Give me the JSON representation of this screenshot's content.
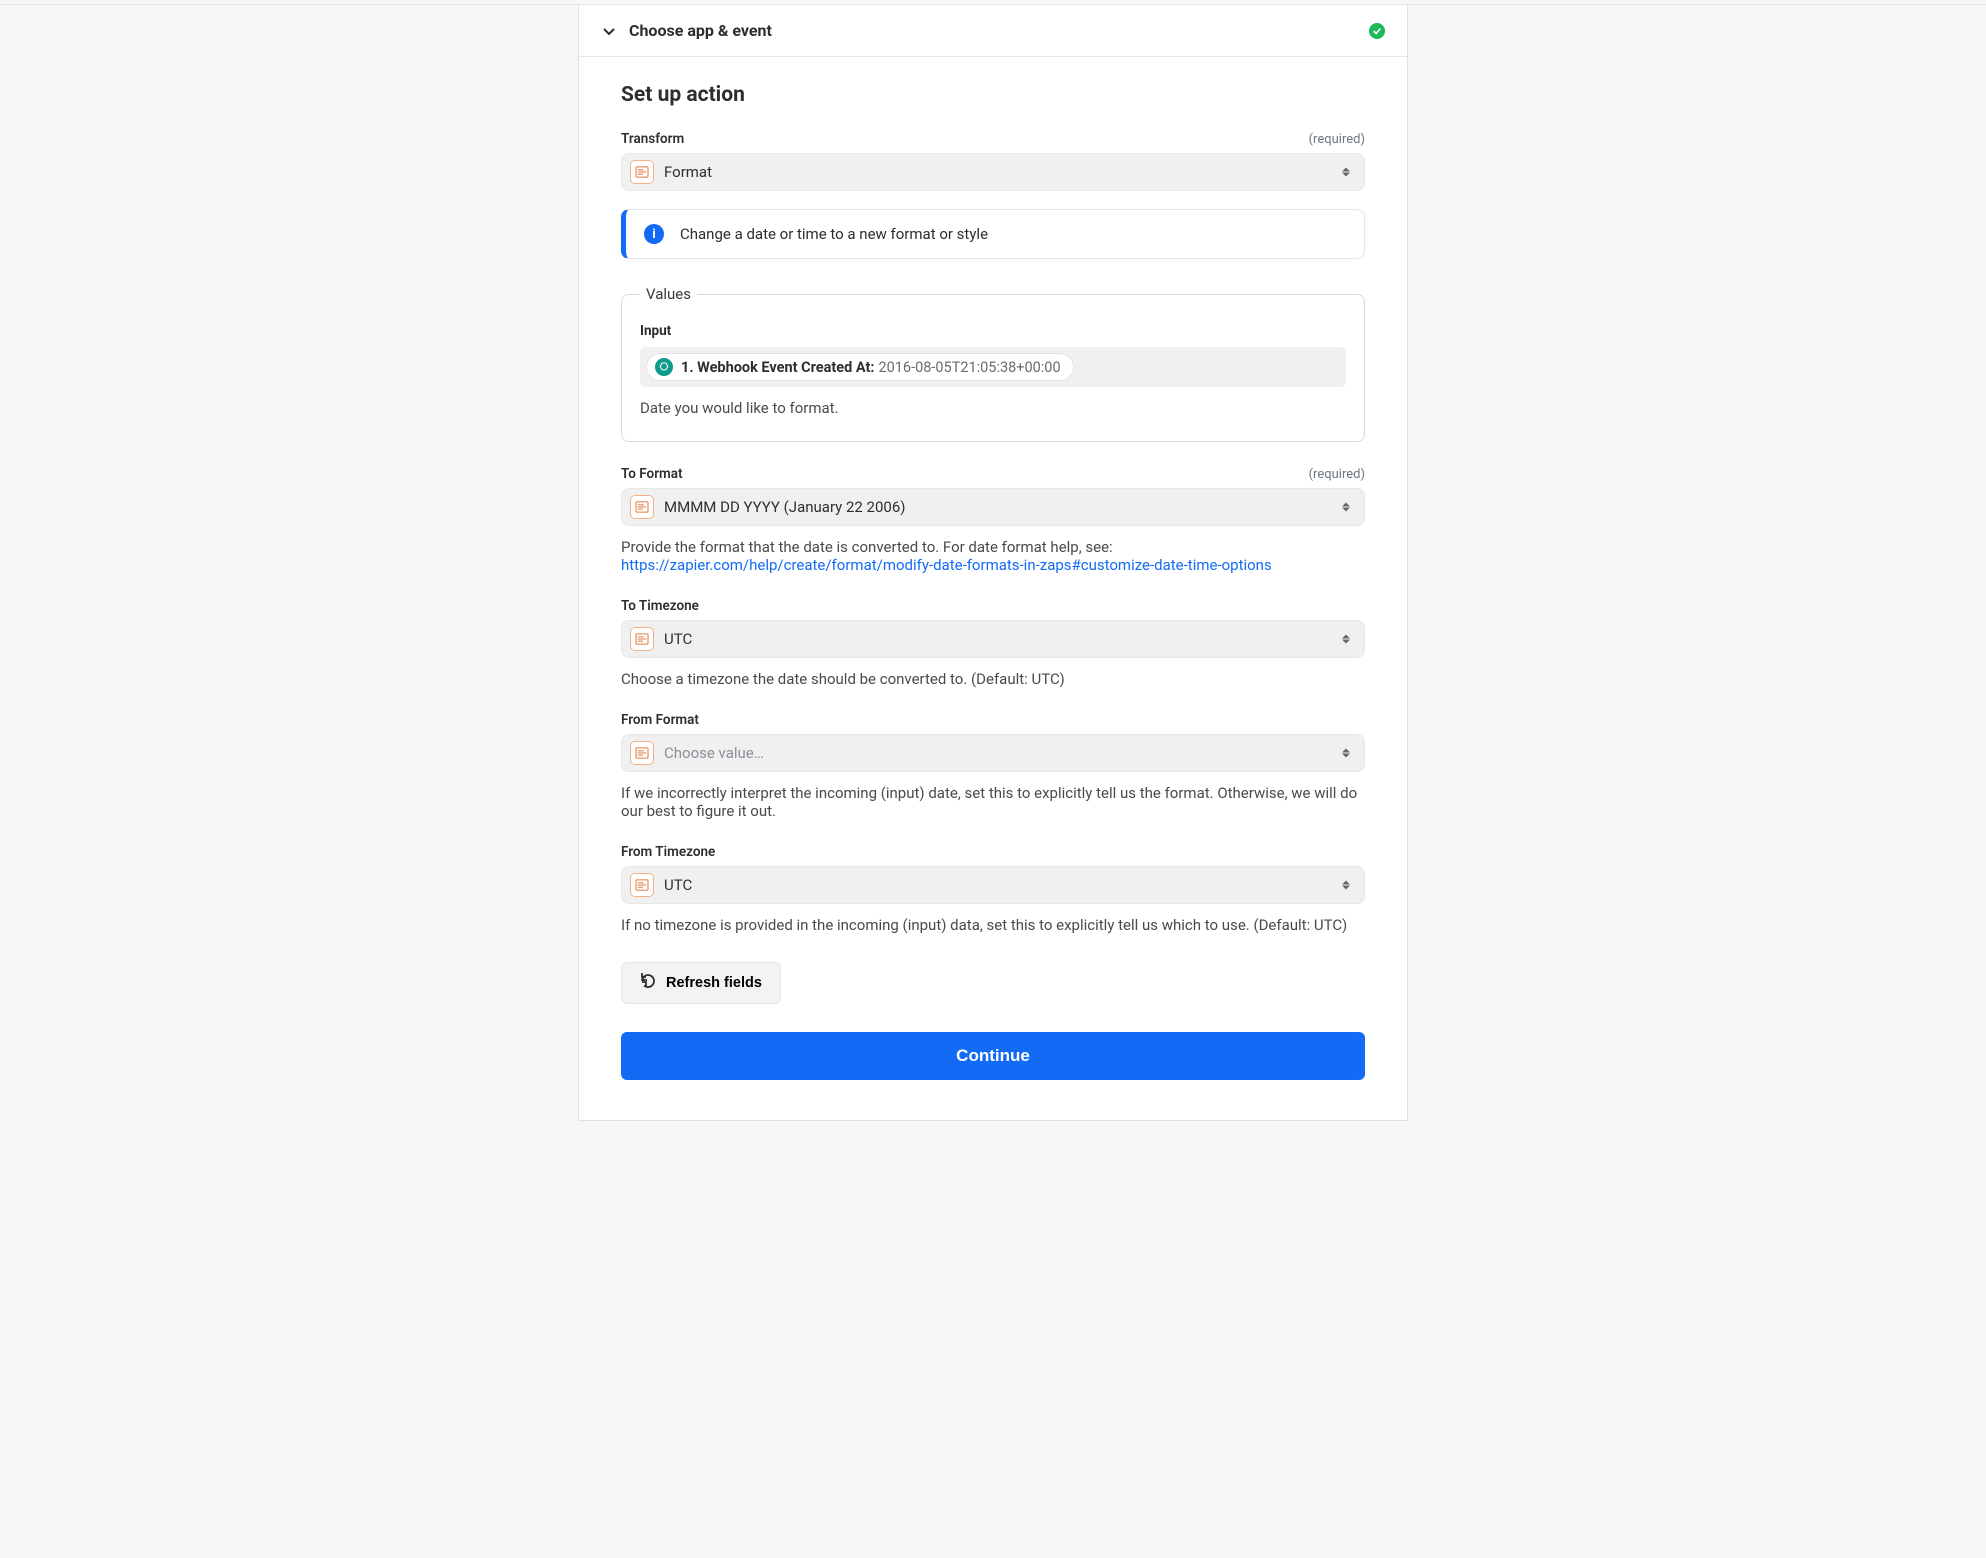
{
  "header": {
    "title": "Choose app & event"
  },
  "section": {
    "title": "Set up action"
  },
  "transform": {
    "label": "Transform",
    "required": "(required)",
    "value": "Format",
    "info": "Change a date or time to a new format or style"
  },
  "values": {
    "legend": "Values",
    "input_label": "Input",
    "pill_label": "1. Webhook Event Created At:",
    "pill_value": "2016-08-05T21:05:38+00:00",
    "hint": "Date you would like to format."
  },
  "to_format": {
    "label": "To Format",
    "required": "(required)",
    "value": "MMMM DD YYYY (January 22 2006)",
    "hint_text": "Provide the format that the date is converted to. For date format help, see:",
    "hint_link": "https://zapier.com/help/create/format/modify-date-formats-in-zaps#customize-date-time-options"
  },
  "to_timezone": {
    "label": "To Timezone",
    "value": "UTC",
    "hint": "Choose a timezone the date should be converted to. (Default: UTC)"
  },
  "from_format": {
    "label": "From Format",
    "placeholder": "Choose value…",
    "hint": "If we incorrectly interpret the incoming (input) date, set this to explicitly tell us the format. Otherwise, we will do our best to figure it out."
  },
  "from_timezone": {
    "label": "From Timezone",
    "value": "UTC",
    "hint": "If no timezone is provided in the incoming (input) data, set this to explicitly tell us which to use. (Default: UTC)"
  },
  "buttons": {
    "refresh": "Refresh fields",
    "continue": "Continue"
  }
}
